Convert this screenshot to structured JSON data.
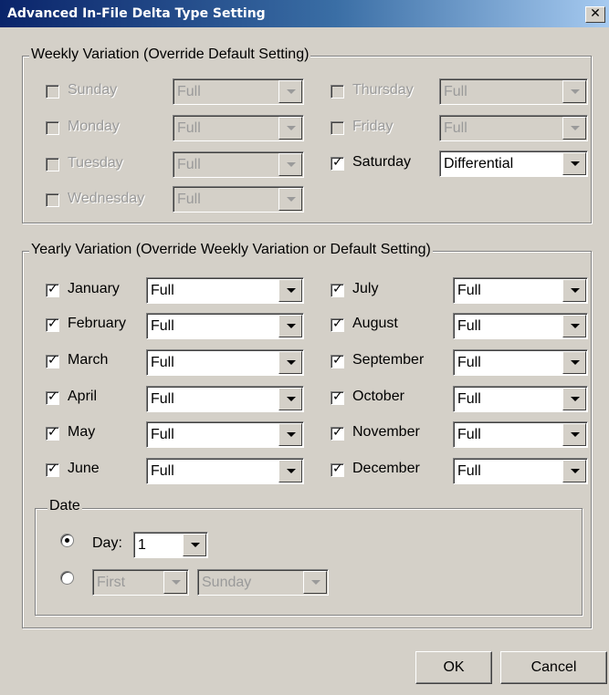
{
  "window": {
    "title": "Advanced In-File Delta Type Setting"
  },
  "weekly": {
    "legend": "Weekly Variation (Override Default Setting)",
    "days": [
      {
        "label": "Sunday",
        "checked": false,
        "value": "Full"
      },
      {
        "label": "Monday",
        "checked": false,
        "value": "Full"
      },
      {
        "label": "Tuesday",
        "checked": false,
        "value": "Full"
      },
      {
        "label": "Wednesday",
        "checked": false,
        "value": "Full"
      },
      {
        "label": "Thursday",
        "checked": false,
        "value": "Full"
      },
      {
        "label": "Friday",
        "checked": false,
        "value": "Full"
      },
      {
        "label": "Saturday",
        "checked": true,
        "value": "Differential"
      }
    ]
  },
  "yearly": {
    "legend": "Yearly Variation (Override Weekly Variation or Default Setting)",
    "months": [
      {
        "label": "January",
        "checked": true,
        "value": "Full"
      },
      {
        "label": "February",
        "checked": true,
        "value": "Full"
      },
      {
        "label": "March",
        "checked": true,
        "value": "Full"
      },
      {
        "label": "April",
        "checked": true,
        "value": "Full"
      },
      {
        "label": "May",
        "checked": true,
        "value": "Full"
      },
      {
        "label": "June",
        "checked": true,
        "value": "Full"
      },
      {
        "label": "July",
        "checked": true,
        "value": "Full"
      },
      {
        "label": "August",
        "checked": true,
        "value": "Full"
      },
      {
        "label": "September",
        "checked": true,
        "value": "Full"
      },
      {
        "label": "October",
        "checked": true,
        "value": "Full"
      },
      {
        "label": "November",
        "checked": true,
        "value": "Full"
      },
      {
        "label": "December",
        "checked": true,
        "value": "Full"
      }
    ],
    "date": {
      "legend": "Date",
      "day_label": "Day:",
      "day_value": "1",
      "day_selected": true,
      "ordinal_value": "First",
      "weekday_value": "Sunday"
    }
  },
  "buttons": {
    "ok": "OK",
    "cancel": "Cancel"
  },
  "icons": {
    "close": "close-icon",
    "check": "check-icon",
    "dropdown": "chevron-down-icon"
  }
}
